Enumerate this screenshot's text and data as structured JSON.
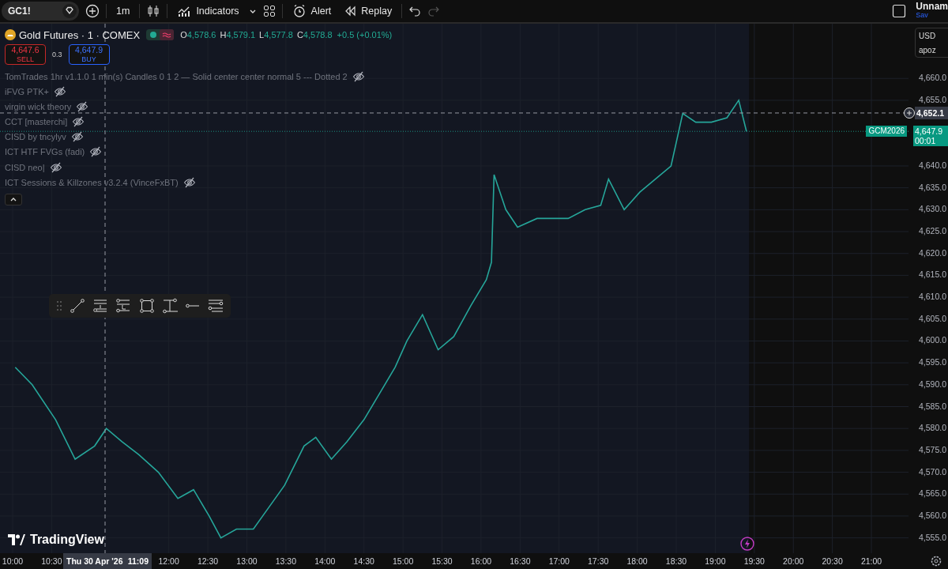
{
  "toolbar": {
    "symbol": "GC1!",
    "interval": "1m",
    "indicators_label": "Indicators",
    "alert_label": "Alert",
    "replay_label": "Replay"
  },
  "layout": {
    "name": "Unnam",
    "save_status": "Sav"
  },
  "legend": {
    "title": "Gold Futures · 1 · COMEX",
    "o_label": "O",
    "o": "4,578.6",
    "h_label": "H",
    "h": "4,579.1",
    "l_label": "L",
    "l": "4,577.8",
    "c_label": "C",
    "c": "4,578.8",
    "change": "+0.5 (+0.01%)"
  },
  "trade": {
    "sell_price": "4,647.6",
    "sell_label": "SELL",
    "spread": "0.3",
    "buy_price": "4,647.9",
    "buy_label": "BUY"
  },
  "indicators": [
    {
      "name": "TomTrades 1hr v1.1.0 1 min(s) Candles 0 1 2 — Solid center center normal 5 --- Dotted 2",
      "hidden": true
    },
    {
      "name": "iFVG PTK+",
      "hidden": true
    },
    {
      "name": "virgin wick theory",
      "hidden": true
    },
    {
      "name": "CCT [masterchi]",
      "hidden": true
    },
    {
      "name": "CISD by tncylyv",
      "hidden": true
    },
    {
      "name": "ICT HTF FVGs (fadi)",
      "hidden": true
    },
    {
      "name": "CISD neo|",
      "hidden": true
    },
    {
      "name": "ICT Sessions & Killzones v3.2.4 (VinceFxBT)",
      "hidden": true
    }
  ],
  "price_scale": {
    "currency": "USD",
    "unit": "apoz"
  },
  "crosshair": {
    "price": "4,652.1",
    "date": "Thu 30 Apr '26",
    "time": "11:09"
  },
  "last_price": {
    "symbol": "GCM2026",
    "price": "4,647.9",
    "countdown": "00:01"
  },
  "brand": "TradingView",
  "chart_data": {
    "type": "line",
    "grid": true,
    "bands": [
      {
        "axis": "x",
        "from": 9.838,
        "to": 19.433,
        "color": "#131722"
      }
    ],
    "ref_lines": [
      {
        "axis": "y",
        "value": 4647.9,
        "color": "#1b8f80"
      },
      {
        "axis": "y",
        "value": 4652.1,
        "color": "#9598a1"
      },
      {
        "axis": "x",
        "value": 11.184,
        "color": "#9598a1"
      }
    ],
    "xlim": [
      9.838,
      21.475
    ],
    "ylim": [
      4551.5,
      4672.5
    ],
    "x": [
      10.033,
      10.25,
      10.55,
      10.8,
      11.05,
      11.2,
      11.4,
      11.617,
      11.867,
      12.117,
      12.317,
      12.517,
      12.667,
      12.867,
      13.083,
      13.283,
      13.483,
      13.733,
      13.883,
      14.083,
      14.283,
      14.5,
      14.7,
      14.9,
      15.05,
      15.25,
      15.45,
      15.65,
      15.867,
      16.067,
      16.133,
      16.167,
      16.317,
      16.467,
      16.717,
      16.917,
      17.117,
      17.333,
      17.533,
      17.633,
      17.833,
      18.033,
      18.233,
      18.433,
      18.583,
      18.75,
      18.95,
      19.15,
      19.3,
      19.4
    ],
    "series": [
      {
        "color": "#26a69a",
        "values": [
          4594,
          4590,
          4582,
          4573,
          4576,
          4580,
          4577,
          4574,
          4570,
          4564,
          4566,
          4560,
          4555,
          4557,
          4557,
          4562,
          4567,
          4576,
          4578,
          4573,
          4577,
          4582,
          4588,
          4594,
          4600,
          4606,
          4598,
          4601,
          4608,
          4614,
          4618,
          4638,
          4630,
          4626,
          4628,
          4628,
          4628,
          4630,
          4631,
          4637,
          4630,
          4634,
          4637,
          4640,
          4652,
          4650,
          4650,
          4651,
          4655,
          4647.9
        ]
      }
    ],
    "xticks": [
      {
        "value": 10,
        "label": "10:00"
      },
      {
        "value": 10.5,
        "label": "10:30"
      },
      {
        "value": 12,
        "label": "12:00"
      },
      {
        "value": 12.5,
        "label": "12:30"
      },
      {
        "value": 13,
        "label": "13:00"
      },
      {
        "value": 13.5,
        "label": "13:30"
      },
      {
        "value": 14,
        "label": "14:00"
      },
      {
        "value": 14.5,
        "label": "14:30"
      },
      {
        "value": 15,
        "label": "15:00"
      },
      {
        "value": 15.5,
        "label": "15:30"
      },
      {
        "value": 16,
        "label": "16:00"
      },
      {
        "value": 16.5,
        "label": "16:30"
      },
      {
        "value": 17,
        "label": "17:00"
      },
      {
        "value": 17.5,
        "label": "17:30"
      },
      {
        "value": 18,
        "label": "18:00"
      },
      {
        "value": 18.5,
        "label": "18:30"
      },
      {
        "value": 19,
        "label": "19:00"
      },
      {
        "value": 19.5,
        "label": "19:30"
      },
      {
        "value": 20,
        "label": "20:00"
      },
      {
        "value": 20.5,
        "label": "20:30"
      },
      {
        "value": 21,
        "label": "21:00"
      }
    ],
    "yticks": [
      {
        "value": 4555,
        "label": "4,555.0"
      },
      {
        "value": 4560,
        "label": "4,560.0"
      },
      {
        "value": 4565,
        "label": "4,565.0"
      },
      {
        "value": 4570,
        "label": "4,570.0"
      },
      {
        "value": 4575,
        "label": "4,575.0"
      },
      {
        "value": 4580,
        "label": "4,580.0"
      },
      {
        "value": 4585,
        "label": "4,585.0"
      },
      {
        "value": 4590,
        "label": "4,590.0"
      },
      {
        "value": 4595,
        "label": "4,595.0"
      },
      {
        "value": 4600,
        "label": "4,600.0"
      },
      {
        "value": 4605,
        "label": "4,605.0"
      },
      {
        "value": 4610,
        "label": "4,610.0"
      },
      {
        "value": 4615,
        "label": "4,615.0"
      },
      {
        "value": 4620,
        "label": "4,620.0"
      },
      {
        "value": 4625,
        "label": "4,625.0"
      },
      {
        "value": 4630,
        "label": "4,630.0"
      },
      {
        "value": 4635,
        "label": "4,635.0"
      },
      {
        "value": 4640,
        "label": "4,640.0"
      },
      {
        "value": 4655,
        "label": "4,655.0"
      },
      {
        "value": 4660,
        "label": "4,660.0"
      }
    ]
  }
}
